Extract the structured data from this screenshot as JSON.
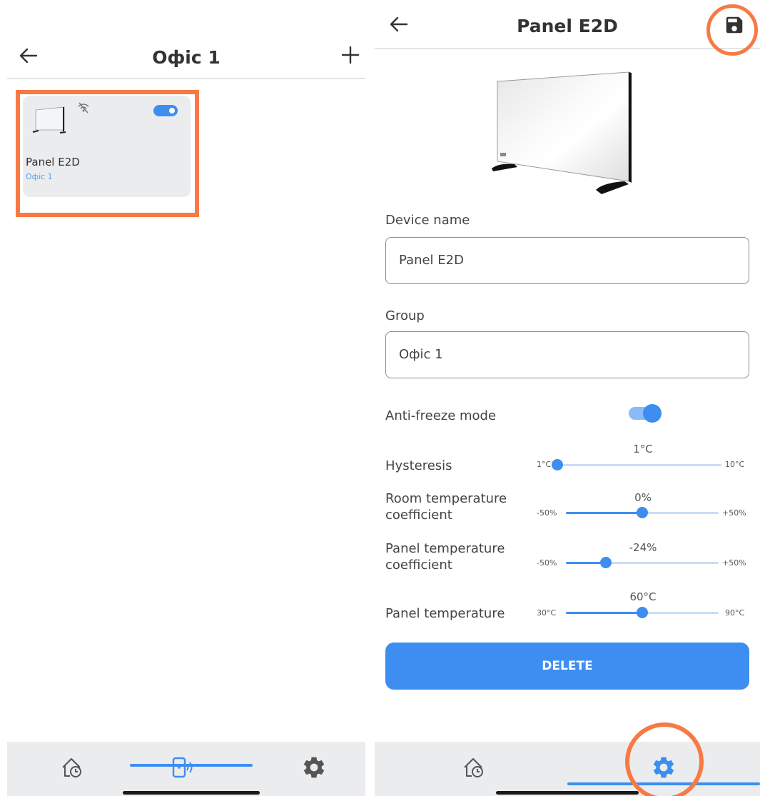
{
  "left": {
    "header": {
      "title": "Офіс 1"
    },
    "device_card": {
      "name": "Panel E2D",
      "group": "Офіс 1",
      "enabled": true
    },
    "tabs": [
      {
        "icon": "home-clock-icon",
        "active": false
      },
      {
        "icon": "device-wireless-icon",
        "active": true
      },
      {
        "icon": "gear-icon",
        "active": false
      }
    ]
  },
  "right": {
    "header": {
      "title": "Panel E2D"
    },
    "fields": {
      "device_name_label": "Device name",
      "device_name_value": "Panel E2D",
      "group_label": "Group",
      "group_value": "Офіс 1"
    },
    "antifreeze": {
      "label": "Anti-freeze mode",
      "enabled": true
    },
    "sliders": [
      {
        "label": "Hysteresis",
        "value_text": "1°C",
        "min_label": "1°C",
        "max_label": "10°C",
        "min": 1,
        "max": 10,
        "value": 1
      },
      {
        "label": "Room temperature coefficient",
        "value_text": "0%",
        "min_label": "-50%",
        "max_label": "+50%",
        "min": -50,
        "max": 50,
        "value": 0
      },
      {
        "label": "Panel temperature coefficient",
        "value_text": "-24%",
        "min_label": "-50%",
        "max_label": "+50%",
        "min": -50,
        "max": 50,
        "value": -24
      },
      {
        "label": "Panel temperature",
        "value_text": "60°C",
        "min_label": "30°C",
        "max_label": "90°C",
        "min": 30,
        "max": 90,
        "value": 60
      }
    ],
    "delete_label": "DELETE",
    "tabs": [
      {
        "icon": "home-clock-icon",
        "active": false
      },
      {
        "icon": "gear-icon",
        "active": true
      }
    ]
  },
  "colors": {
    "accent": "#3d8ef0",
    "highlight": "#f77a45",
    "tabbar": "#ebecee"
  }
}
